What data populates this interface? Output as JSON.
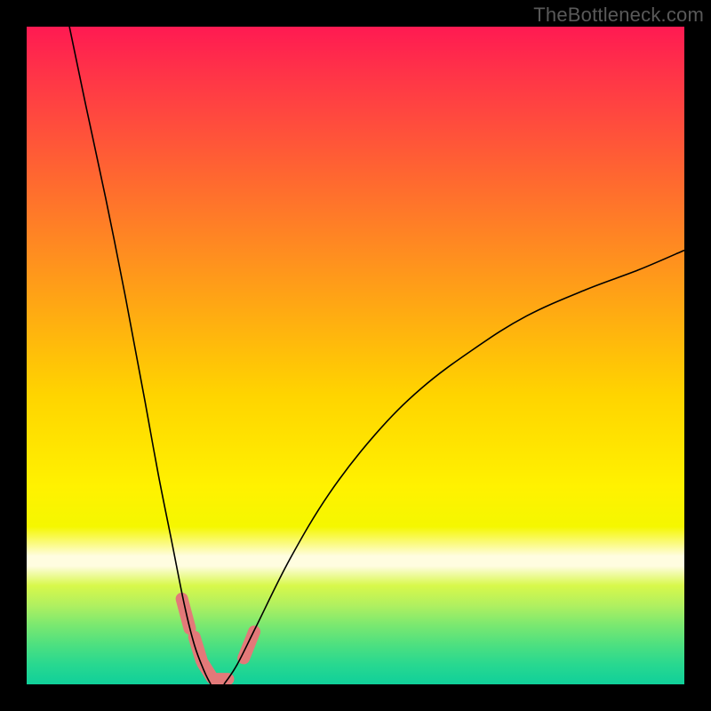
{
  "attribution": "TheBottleneck.com",
  "colors": {
    "frame": "#000000",
    "curve": "#000000",
    "markers": "#e37979"
  },
  "chart_data": {
    "type": "line",
    "title": "",
    "xlabel": "",
    "ylabel": "",
    "xlim": [
      0,
      100
    ],
    "ylim": [
      0,
      100
    ],
    "note": "Bottleneck-style V curve. y ≈ bottleneck percentage (lower = better). Minimum near x ≈ 27 where y ≈ 0. Left branch rises to ~100 at x=0; right branch rises to ~66 at x=100.",
    "series": [
      {
        "name": "left-branch",
        "x": [
          6.5,
          9,
          12,
          15,
          18,
          20,
          22,
          24,
          25.5,
          27,
          28
        ],
        "y": [
          100,
          88,
          74,
          59,
          43,
          32,
          22,
          12,
          6,
          2,
          0
        ]
      },
      {
        "name": "right-branch",
        "x": [
          30,
          32,
          35,
          40,
          46,
          53,
          60,
          68,
          76,
          85,
          93,
          100
        ],
        "y": [
          0,
          3,
          9,
          19,
          29,
          38,
          45,
          51,
          56,
          60,
          63,
          66
        ]
      }
    ],
    "markers": {
      "note": "Short pink capsule segments near the trough indicating sample points/range.",
      "segments": [
        {
          "x1": 23.6,
          "y1": 13.0,
          "x2": 24.8,
          "y2": 8.5
        },
        {
          "x1": 25.5,
          "y1": 7.2,
          "x2": 26.6,
          "y2": 3.6
        },
        {
          "x1": 26.8,
          "y1": 3.2,
          "x2": 28.2,
          "y2": 1.0
        },
        {
          "x1": 28.4,
          "y1": 0.8,
          "x2": 30.6,
          "y2": 0.8
        },
        {
          "x1": 33.0,
          "y1": 4.0,
          "x2": 34.6,
          "y2": 8.0
        }
      ]
    },
    "gradient_stops": [
      {
        "pos": 0.0,
        "color": "#ff1a52"
      },
      {
        "pos": 0.49,
        "color": "#ffd400"
      },
      {
        "pos": 0.81,
        "color": "#fffde0"
      },
      {
        "pos": 1.0,
        "color": "#10d09a"
      }
    ]
  }
}
